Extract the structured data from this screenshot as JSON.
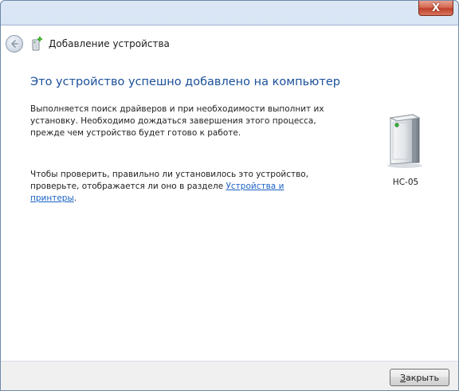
{
  "window": {
    "close_glyph": "X"
  },
  "navbar": {
    "title": "Добавление устройства",
    "back_icon": "back-arrow-icon",
    "title_icon": "device-add-icon"
  },
  "main": {
    "heading": "Это устройство успешно добавлено на компьютер",
    "paragraph1": "Выполняется поиск драйверов и при необходимости выполнит их установку. Необходимо дождаться завершения этого процесса, прежде чем устройство будет готово к работе.",
    "paragraph2_prefix": "Чтобы проверить, правильно ли установилось это устройство, проверьте, отображается ли оно в разделе ",
    "paragraph2_link": "Устройства и принтеры",
    "paragraph2_suffix": "."
  },
  "device": {
    "name": "HC-05",
    "icon": "device-tower-icon"
  },
  "footer": {
    "close_label": "Закрыть"
  },
  "colors": {
    "heading": "#1a4f9a",
    "link": "#1a62c6",
    "close_button_red": "#c0412a"
  }
}
